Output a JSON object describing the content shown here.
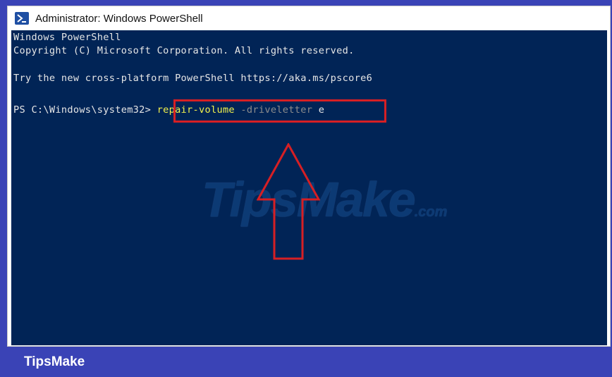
{
  "window": {
    "title": "Administrator: Windows PowerShell",
    "icon": "powershell-icon"
  },
  "console": {
    "lines": [
      "Windows PowerShell",
      "Copyright (C) Microsoft Corporation. All rights reserved.",
      "",
      "Try the new cross-platform PowerShell https://aka.ms/pscore6",
      ""
    ],
    "prompt": "PS C:\\Windows\\system32>",
    "command": {
      "cmdlet": "repair-volume",
      "parameter": "-driveletter",
      "argument": "e"
    },
    "background_color": "#012456",
    "cmdlet_color": "#f2f24b",
    "parameter_color": "#8c8c8c"
  },
  "annotation": {
    "highlight_color": "#d61f24",
    "arrow_direction": "up"
  },
  "watermark": {
    "text": "TipsMake",
    "suffix": ".com"
  },
  "footer": {
    "brand": "TipsMake",
    "background_color": "#3a43b6"
  }
}
